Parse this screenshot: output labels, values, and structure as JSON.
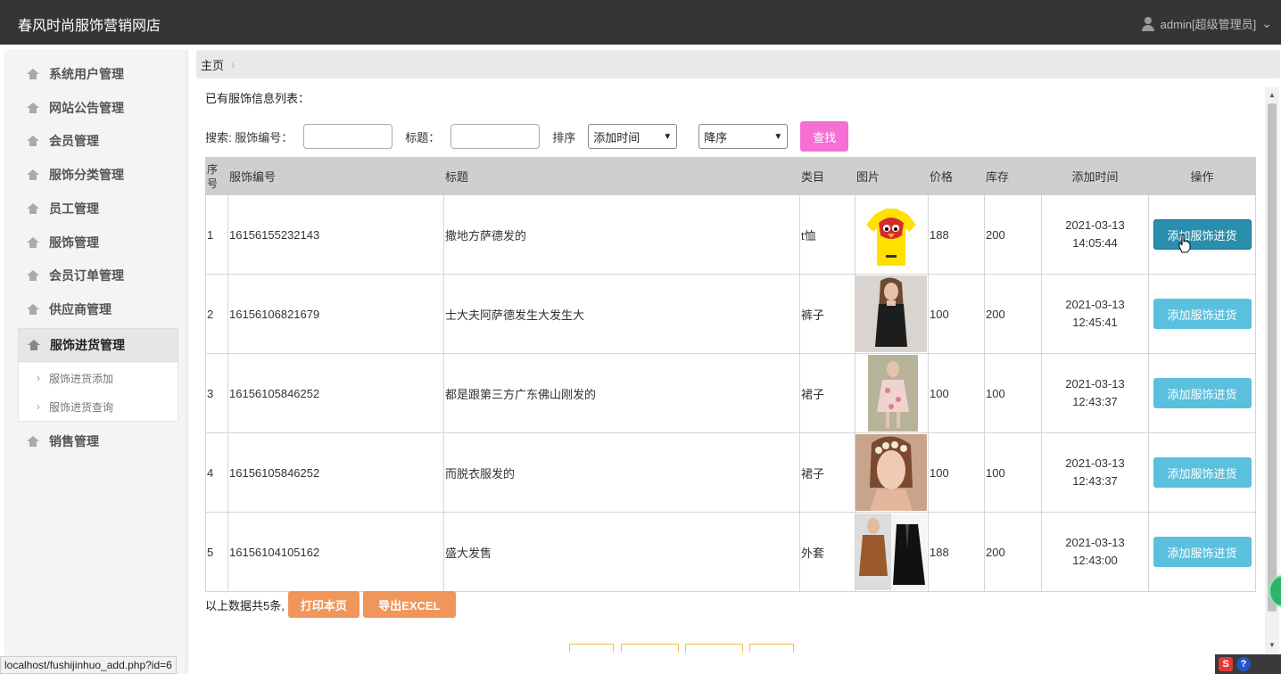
{
  "topbar": {
    "brand": "春风时尚服饰营销网店",
    "user": "admin[超级管理员]",
    "user_caret": "⌄"
  },
  "sidebar": {
    "items": [
      {
        "label": "系统用户管理",
        "icon": "home-icon"
      },
      {
        "label": "网站公告管理",
        "icon": "home-icon"
      },
      {
        "label": "会员管理",
        "icon": "home-icon"
      },
      {
        "label": "服饰分类管理",
        "icon": "home-icon"
      },
      {
        "label": "员工管理",
        "icon": "home-icon"
      },
      {
        "label": "服饰管理",
        "icon": "home-icon"
      },
      {
        "label": "会员订单管理",
        "icon": "home-icon"
      },
      {
        "label": "供应商管理",
        "icon": "home-icon"
      },
      {
        "label": "服饰进货管理",
        "icon": "home-icon",
        "active": true
      },
      {
        "label": "销售管理",
        "icon": "home-icon"
      }
    ],
    "submenu": [
      {
        "label": "服饰进货添加"
      },
      {
        "label": "服饰进货查询"
      }
    ]
  },
  "breadcrumb": {
    "home": "主页",
    "sep": "›"
  },
  "main": {
    "list_title": "已有服饰信息列表：",
    "search": {
      "prefix": "搜索: 服饰编号：",
      "code_value": "",
      "title_label": "标题：",
      "title_value": "",
      "sort_label": "排序",
      "sort_field": "添加时间",
      "sort_order": "降序",
      "search_button": "查找"
    },
    "table": {
      "headers": [
        "序号",
        "服饰编号",
        "标题",
        "类目",
        "图片",
        "价格",
        "库存",
        "添加时间",
        "操作"
      ],
      "rows": [
        {
          "index": "1",
          "code": "16156155232143",
          "title": "撒地方萨德发的",
          "category": "t恤",
          "price": "188",
          "stock": "200",
          "date": "2021-03-13",
          "time": "14:05:44",
          "action": "添加服饰进货",
          "image": "yellow-bird-tshirt"
        },
        {
          "index": "2",
          "code": "16156106821679",
          "title": "士大夫阿萨德发生大发生大",
          "category": "裤子",
          "price": "100",
          "stock": "200",
          "date": "2021-03-13",
          "time": "12:45:41",
          "action": "添加服饰进货",
          "image": "black-dress-model"
        },
        {
          "index": "3",
          "code": "16156105846252",
          "title": "都是跟第三方广东佛山刚发的",
          "category": "裙子",
          "price": "100",
          "stock": "100",
          "date": "2021-03-13",
          "time": "12:43:37",
          "action": "添加服饰进货",
          "image": "floral-dress-model"
        },
        {
          "index": "4",
          "code": "16156105846252",
          "title": "而脱衣服发的",
          "category": "裙子",
          "price": "100",
          "stock": "100",
          "date": "2021-03-13",
          "time": "12:43:37",
          "action": "添加服饰进货",
          "image": "flower-crown-model"
        },
        {
          "index": "5",
          "code": "16156104105162",
          "title": "盛大发售",
          "category": "外套",
          "price": "188",
          "stock": "200",
          "date": "2021-03-13",
          "time": "12:43:00",
          "action": "添加服饰进货",
          "image": "coats-model"
        }
      ]
    },
    "footer": {
      "summary": "以上数据共5条,",
      "print_button": "打印本页",
      "export_button": "导出EXCEL"
    }
  },
  "status_url": "localhost/fushijinhuo_add.php?id=6",
  "tray": {
    "s": "S",
    "q": "?"
  }
}
